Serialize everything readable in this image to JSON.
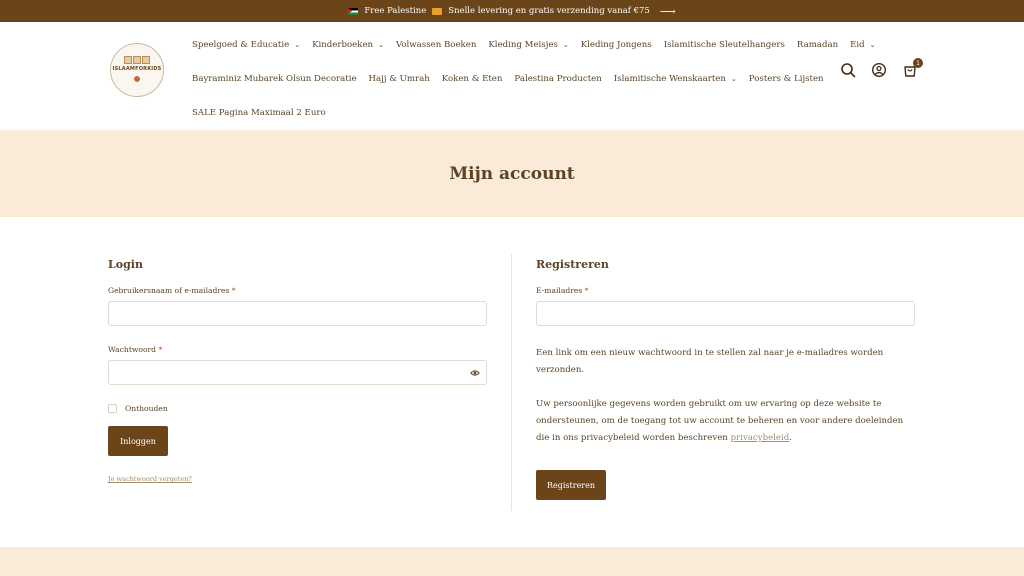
{
  "announcement": {
    "text_before": "Free Palestine",
    "text_after": "Snelle levering en gratis verzending vanaf €75",
    "arrow": "⟶"
  },
  "header": {
    "logo_text": "ISLAAMFORKIDS",
    "nav_rows": [
      [
        {
          "label": "Speelgoed & Educatie",
          "has_submenu": true
        },
        {
          "label": "Kinderboeken",
          "has_submenu": true
        },
        {
          "label": "Volwassen Boeken",
          "has_submenu": false
        },
        {
          "label": "Kleding Meisjes",
          "has_submenu": true
        },
        {
          "label": "Kleding Jongens",
          "has_submenu": false
        },
        {
          "label": "Islamitische Sleutelhangers",
          "has_submenu": false
        },
        {
          "label": "Ramadan",
          "has_submenu": false
        },
        {
          "label": "Eid",
          "has_submenu": true
        }
      ],
      [
        {
          "label": "Bayraminiz Mubarek Olsun Decoratie",
          "has_submenu": false
        },
        {
          "label": "Hajj & Umrah",
          "has_submenu": false
        },
        {
          "label": "Koken & Eten",
          "has_submenu": false
        },
        {
          "label": "Palestina Producten",
          "has_submenu": false
        },
        {
          "label": "Islamitische Wenskaarten",
          "has_submenu": true
        },
        {
          "label": "Posters & Lijsten",
          "has_submenu": false
        }
      ],
      [
        {
          "label": "SALE Pagina Maximaal 2 Euro",
          "has_submenu": false
        }
      ]
    ],
    "cart_count": "1"
  },
  "page": {
    "title": "Mijn account"
  },
  "login": {
    "title": "Login",
    "username_label": "Gebruikersnaam of e-mailadres",
    "password_label": "Wachtwoord",
    "required_mark": "*",
    "remember_label": "Onthouden",
    "submit_label": "Inloggen",
    "forgot_link": "Je wachtwoord vergeten?"
  },
  "register": {
    "title": "Registreren",
    "email_label": "E-mailadres",
    "required_mark": "*",
    "info_text": "Een link om een nieuw wachtwoord in te stellen zal naar je e-mailadres worden verzonden.",
    "privacy_text": "Uw persoonlijke gegevens worden gebruikt om uw ervaring op deze website te ondersteunen, om de toegang tot uw account te beheren en voor andere doeleinden die in ons privacybeleid worden beschreven",
    "privacy_link": "privacybeleid",
    "privacy_end": ".",
    "submit_label": "Registreren"
  },
  "colors": {
    "brand_brown": "#6b4519",
    "hero_beige": "#f9ebd8",
    "text": "#5a4326",
    "required": "#c0392b"
  }
}
